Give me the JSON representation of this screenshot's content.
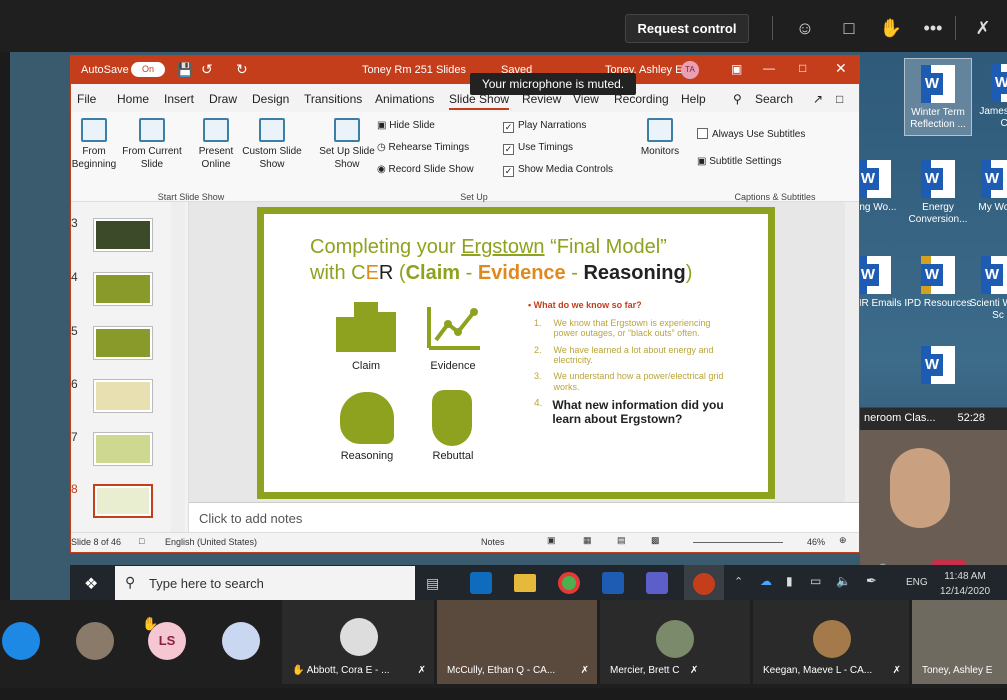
{
  "teams": {
    "request_control": "Request control",
    "icons": [
      "participants-icon",
      "chat-icon",
      "raise-hand-icon",
      "more-icon",
      "camera-off-icon"
    ]
  },
  "ppt": {
    "autosave": "AutoSave",
    "autosave_state": "On",
    "doc_title": "Toney Rm 251 Slides",
    "saved": "Saved",
    "user_name": "Toney, Ashley E",
    "user_initials": "TA",
    "tooltip": "Your microphone is muted.",
    "menu": [
      "File",
      "Home",
      "Insert",
      "Draw",
      "Design",
      "Transitions",
      "Animations",
      "Slide Show",
      "Review",
      "View",
      "Recording",
      "Help"
    ],
    "search": "Search",
    "ribbon": {
      "from_beginning": "From Beginning",
      "from_current": "From Current Slide",
      "present_online": "Present Online",
      "custom_show": "Custom Slide Show",
      "group_start": "Start Slide Show",
      "set_up": "Set Up Slide Show",
      "hide_slide": "Hide Slide",
      "rehearse": "Rehearse Timings",
      "record": "Record Slide Show",
      "play_narrations": "Play Narrations",
      "use_timings": "Use Timings",
      "show_media": "Show Media Controls",
      "group_setup": "Set Up",
      "monitors": "Monitors",
      "always_subtitles": "Always Use Subtitles",
      "subtitle_settings": "Subtitle Settings",
      "group_captions": "Captions & Subtitles"
    },
    "slide_numbers": [
      "3",
      "4",
      "5",
      "6",
      "7",
      "8"
    ],
    "notes_placeholder": "Click to add notes",
    "status": {
      "slide_of": "Slide 8 of 46",
      "language": "English (United States)",
      "notes": "Notes",
      "zoom": "46%"
    }
  },
  "slide": {
    "title_line1_a": "Completing your ",
    "title_line1_b": "Ergstown",
    "title_line1_c": " “Final Model”",
    "title_line2_a": "with ",
    "title_c": "C",
    "title_e": "E",
    "title_r": "R",
    "title_line2_b": " (",
    "claim": "Claim",
    "dash1": " - ",
    "evidence": "Evidence",
    "dash2": " - ",
    "reasoning": "Reasoning",
    "close": ")",
    "labels": [
      "Claim",
      "Evidence",
      "Reasoning",
      "Rebuttal"
    ],
    "heading": "• What do we know so far?",
    "bullets": [
      {
        "n": "1.",
        "t": "We know that Ergstown is experiencing power outages, or “black outs” often."
      },
      {
        "n": "2.",
        "t": "We have learned a lot about energy and electricity."
      },
      {
        "n": "3.",
        "t": "We understand how a power/electrical grid works."
      }
    ],
    "q_num": "4.",
    "question": "What new information did you learn about Ergstown?"
  },
  "desktop": [
    {
      "label": "Winter Term Reflection ..."
    },
    {
      "label": "Jamesto and Col"
    },
    {
      "label": "ning Wo..."
    },
    {
      "label": "Energy Conversion..."
    },
    {
      "label": "My Work"
    },
    {
      "label": "y HR Emails"
    },
    {
      "label": "IPD Resources"
    },
    {
      "label": "Scienti Word Sc"
    }
  ],
  "call": {
    "title": "neroom Clas...",
    "time": "52:28"
  },
  "taskbar": {
    "search": "Type here to search",
    "lang": "ENG",
    "time": "11:48 AM",
    "date": "12/14/2020"
  },
  "participants": [
    {
      "name": "LS"
    },
    {
      "name": "Abbott, Cora E - ..."
    },
    {
      "name": "McCully, Ethan Q - CA..."
    },
    {
      "name": "Mercier, Brett C"
    },
    {
      "name": "Keegan, Maeve L - CA..."
    },
    {
      "name": "Toney, Ashley E"
    }
  ],
  "colors": {
    "ppt_red": "#c43e1c",
    "slide_green": "#8fa21f",
    "evidence_orange": "#e08a1e"
  }
}
